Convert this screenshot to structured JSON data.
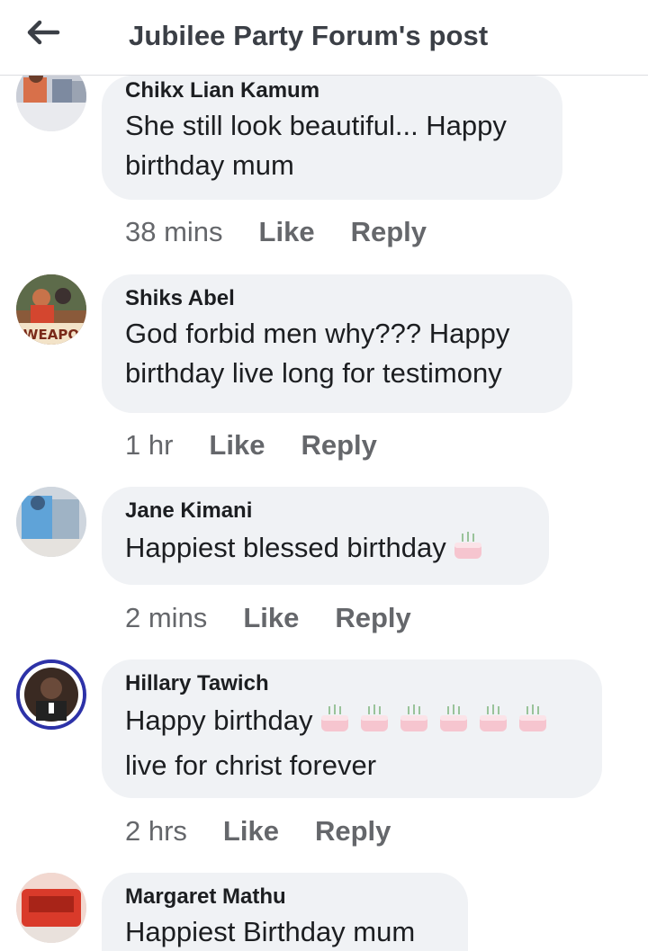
{
  "header": {
    "title": "Jubilee Party Forum's post"
  },
  "comments": [
    {
      "author": "Chikx Lian Kamum",
      "text": "She still look beautiful... Happy birthday mum",
      "time": "38 mins",
      "like_label": "Like",
      "reply_label": "Reply"
    },
    {
      "author": "Shiks Abel",
      "text": "God forbid men why???  Happy birthday live long for testimony",
      "time": "1 hr",
      "like_label": "Like",
      "reply_label": "Reply"
    },
    {
      "author": "Jane Kimani",
      "text": "Happiest blessed birthday",
      "emoji": "birthday-cake",
      "time": "2 mins",
      "like_label": "Like",
      "reply_label": "Reply"
    },
    {
      "author": "Hillary Tawich",
      "text_before": "Happy birthday",
      "emoji": "birthday-cake",
      "emoji_count": 6,
      "text_after": "live for christ forever",
      "time": "2 hrs",
      "like_label": "Like",
      "reply_label": "Reply"
    },
    {
      "author": "Margaret Mathu",
      "text": "Happiest Birthday mum"
    }
  ],
  "avatar_image_text": "WEAPO",
  "colors": {
    "bubble": "#f0f2f5",
    "meta_text": "#65676b",
    "title": "#3b3f46"
  }
}
